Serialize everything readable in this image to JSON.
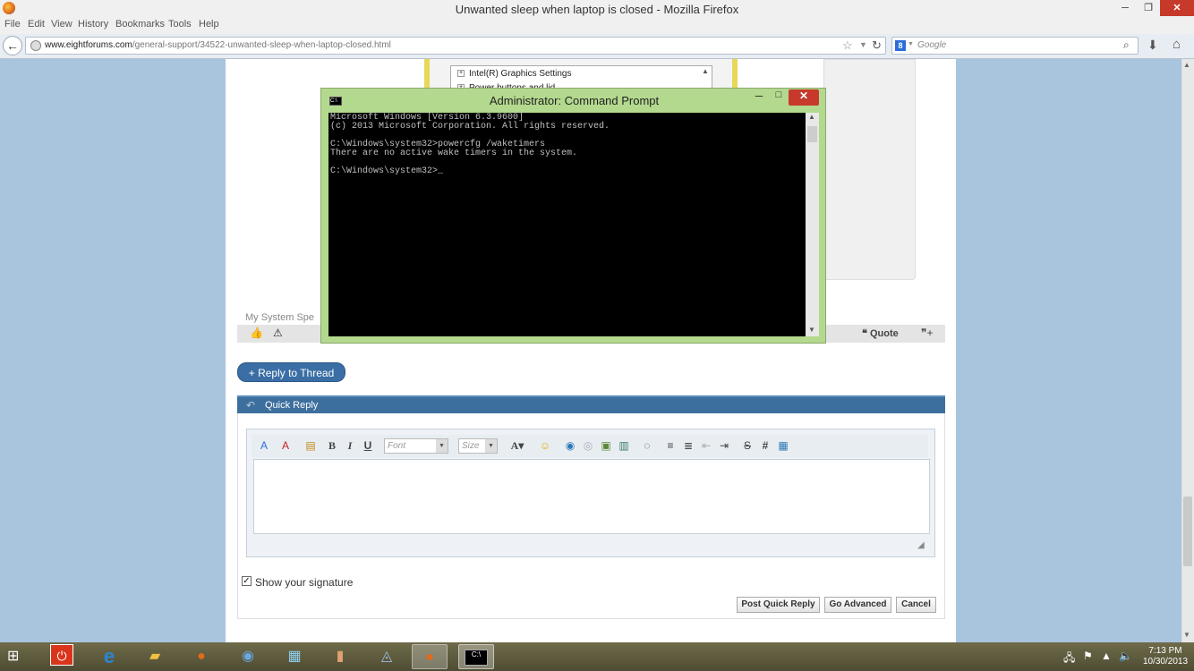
{
  "window": {
    "title": "Unwanted sleep when laptop is closed - Mozilla Firefox",
    "minimize": "─",
    "restore": "❐",
    "close": "✕"
  },
  "menu": [
    "File",
    "Edit",
    "View",
    "History",
    "Bookmarks",
    "Tools",
    "Help"
  ],
  "nav": {
    "url_domain": "www.eightforums.com",
    "url_path": "/general-support/34522-unwanted-sleep-when-laptop-closed.html",
    "search_placeholder": "Google",
    "search_engine_letter": "8"
  },
  "post": {
    "tree_items": [
      "Intel(R) Graphics Settings",
      "Power buttons and lid"
    ],
    "my_system_specs": "My System Spe",
    "quote_label": "Quote"
  },
  "cmd": {
    "title": "Administrator: Command Prompt",
    "lines": [
      "Microsoft Windows [Version 6.3.9600]",
      "(c) 2013 Microsoft Corporation. All rights reserved.",
      "",
      "C:\\Windows\\system32>powercfg /waketimers",
      "There are no active wake timers in the system.",
      "",
      "C:\\Windows\\system32>_"
    ]
  },
  "reply": {
    "reply_to_thread": "+ Reply to Thread",
    "quick_reply_title": "Quick Reply",
    "font_placeholder": "Font",
    "size_placeholder": "Size",
    "show_signature": "Show your signature",
    "show_signature_checked": true,
    "post_quick_reply": "Post Quick Reply",
    "go_advanced": "Go Advanced",
    "cancel": "Cancel"
  },
  "taskbar": {
    "time": "7:13 PM",
    "date": "10/30/2013"
  },
  "colors": {
    "accent": "#3d6f9e",
    "cmd_frame": "#b3d98e",
    "close_red": "#c7392b"
  }
}
